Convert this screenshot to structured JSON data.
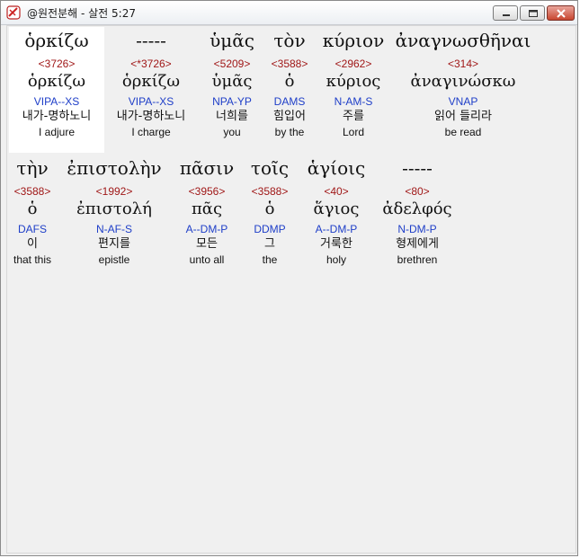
{
  "window": {
    "title": "@원전분해 - 살전 5:27",
    "buttons": {
      "minimize": "minimize",
      "maximize": "maximize",
      "close": "close"
    }
  },
  "rows": [
    {
      "words": [
        {
          "greek": "ὁρκίζω",
          "strong": "<3726>",
          "lemma": "ὁρκίζω",
          "parsing": "VIPA--XS",
          "korean": "내가-명하노니",
          "english": "I adjure",
          "selected": true
        },
        {
          "greek": "-----",
          "strong": "<*3726>",
          "lemma": "ὁρκίζω",
          "parsing": "VIPA--XS",
          "korean": "내가-명하노니",
          "english": "I charge"
        },
        {
          "greek": "ὑμᾶς",
          "strong": "<5209>",
          "lemma": "ὑμᾶς",
          "parsing": "NPA-YP",
          "korean": "너희를",
          "english": "you"
        },
        {
          "greek": "τὸν",
          "strong": "<3588>",
          "lemma": "ὁ",
          "parsing": "DAMS",
          "korean": "힘입어",
          "english": "by the"
        },
        {
          "greek": "κύριον",
          "strong": "<2962>",
          "lemma": "κύριος",
          "parsing": "N-AM-S",
          "korean": "주를",
          "english": "Lord"
        },
        {
          "greek": "ἀναγνωσθῆναι",
          "strong": "<314>",
          "lemma": "ἀναγινώσκω",
          "parsing": "VNAP",
          "korean": "읽어 들리라",
          "english": "be read"
        }
      ]
    },
    {
      "words": [
        {
          "greek": "τὴν",
          "strong": "<3588>",
          "lemma": "ὁ",
          "parsing": "DAFS",
          "korean": "이",
          "english": "that this"
        },
        {
          "greek": "ἐπιστολὴν",
          "strong": "<1992>",
          "lemma": "ἐπιστολή",
          "parsing": "N-AF-S",
          "korean": "편지를",
          "english": "epistle"
        },
        {
          "greek": "πᾶσιν",
          "strong": "<3956>",
          "lemma": "πᾶς",
          "parsing": "A--DM-P",
          "korean": "모든",
          "english": "unto all"
        },
        {
          "greek": "τοῖς",
          "strong": "<3588>",
          "lemma": "ὁ",
          "parsing": "DDMP",
          "korean": "그",
          "english": "the"
        },
        {
          "greek": "ἁγίοις",
          "strong": "<40>",
          "lemma": "ἅγιος",
          "parsing": "A--DM-P",
          "korean": "거룩한",
          "english": "holy"
        },
        {
          "greek": "-----",
          "strong": "<80>",
          "lemma": "ἀδελφός",
          "parsing": "N-DM-P",
          "korean": "형제에게",
          "english": "brethren"
        }
      ]
    }
  ]
}
